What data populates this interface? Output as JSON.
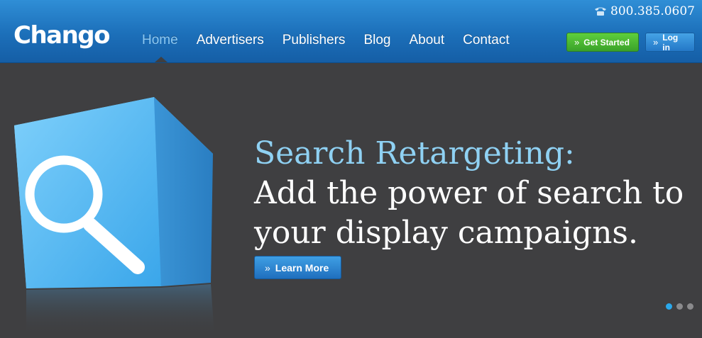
{
  "header": {
    "logo": "Chango",
    "phone": "800.385.0607",
    "phone_icon": "phone-icon",
    "nav": [
      {
        "label": "Home",
        "active": true
      },
      {
        "label": "Advertisers"
      },
      {
        "label": "Publishers"
      },
      {
        "label": "Blog"
      },
      {
        "label": "About"
      },
      {
        "label": "Contact"
      }
    ],
    "get_started_label": "Get Started",
    "login_label": "Log in",
    "chevron": "»"
  },
  "hero": {
    "headline_accent": "Search Retargeting:",
    "headline_line2": "Add the power of search to",
    "headline_line3": "your display campaigns.",
    "learn_more_label": "Learn More",
    "icon": "magnifier-cube-icon",
    "slides": 3,
    "active_slide": 1
  },
  "colors": {
    "header_blue": "#1c6fb9",
    "accent_text": "#8fd1f3",
    "background": "#3f3f41",
    "green_button": "#3aa22a"
  }
}
